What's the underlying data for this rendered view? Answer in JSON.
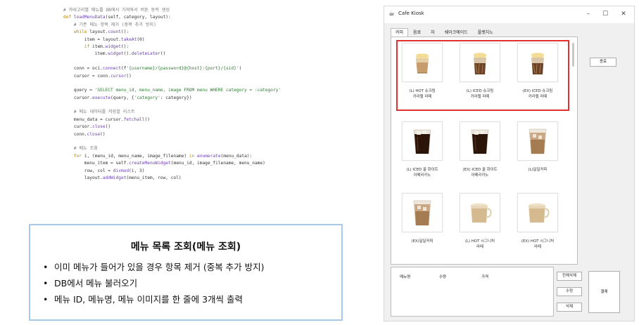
{
  "code_lines": [
    "# 카테고리별 메뉴를 DB에서 가져와서 버튼 동적 생성",
    "def loadMenuData(self, category, layout):",
    "    # 기존 메뉴 항목 제거 (중복 추가 방지)",
    "    while layout.count():",
    "        item = layout.takeAt(0)",
    "        if item.widget():",
    "            item.widget().deleteLater()",
    "",
    "    conn = oci.connect(f'{username}/{password}@{host}:{port}/{sid}')",
    "    cursor = conn.cursor()",
    "",
    "    query = 'SELECT menu_id, menu_name, image FROM menu WHERE category = :category'",
    "    cursor.execute(query, {'category': category})",
    "",
    "    # 메뉴 데이터를 저장할 리스트",
    "    menu_data = cursor.fetchall()",
    "    cursor.close()",
    "    conn.close()",
    "",
    "    # 메뉴 조회",
    "    for i, (menu_id, menu_name, image_filename) in enumerate(menu_data):",
    "        menu_item = self.createMenuWidget(menu_id, image_filename, menu_name)",
    "        row, col = divmod(i, 3)",
    "        layout.addWidget(menu_item, row, col)"
  ],
  "summary": {
    "title": "메뉴 목록 조회(메뉴 조회)",
    "bullet": "•",
    "items": [
      "이미 메뉴가 들어가 있을 경우 항목 제거 (중복 추가 방지)",
      "DB에서 메뉴 불러오기",
      "메뉴 ID, 메뉴명, 메뉴 이미지를 한 줄에 3개씩 출력"
    ]
  },
  "kiosk": {
    "app_icon": "☕",
    "window_title": "Cafe Kiosk",
    "min_glyph": "–",
    "max_glyph": "☐",
    "close_glyph": "✕",
    "tabs": [
      "커피",
      "음료",
      "차",
      "쉐이크에이드",
      "플랫치노"
    ],
    "active_tab": 0,
    "menu_items": [
      {
        "name": "(L) HOT 슈크림\n카라멜 라떼",
        "drink": "hot-latte-cream"
      },
      {
        "name": "(L) ICED 슈크림\n카라멜 라떼",
        "drink": "iced-latte-cream"
      },
      {
        "name": "(EX) ICED 슈크림\n카라멜 라떼",
        "drink": "iced-latte-cream"
      },
      {
        "name": "(L) ICED 꿀 화이트\n아메리카노",
        "drink": "iced-americano"
      },
      {
        "name": "(EX) ICED 꿀 화이트\n아메리카노",
        "drink": "iced-americano"
      },
      {
        "name": "(L)달달커피",
        "drink": "iced-latte"
      },
      {
        "name": "(EX)달달커피",
        "drink": "iced-latte"
      },
      {
        "name": "(L) HOT 시그니처\n라떼",
        "drink": "hot-latte"
      },
      {
        "name": "(EX) HOT 시그니처\n라떼",
        "drink": "hot-latte"
      }
    ],
    "end_button": "종료",
    "order_headers": [
      "메뉴명",
      "수량",
      "가격"
    ],
    "delete_all_button": "전체삭제",
    "edit_button": "수정",
    "delete_button": "삭제",
    "pay_button": "결제",
    "highlight_color": "#e03030"
  }
}
